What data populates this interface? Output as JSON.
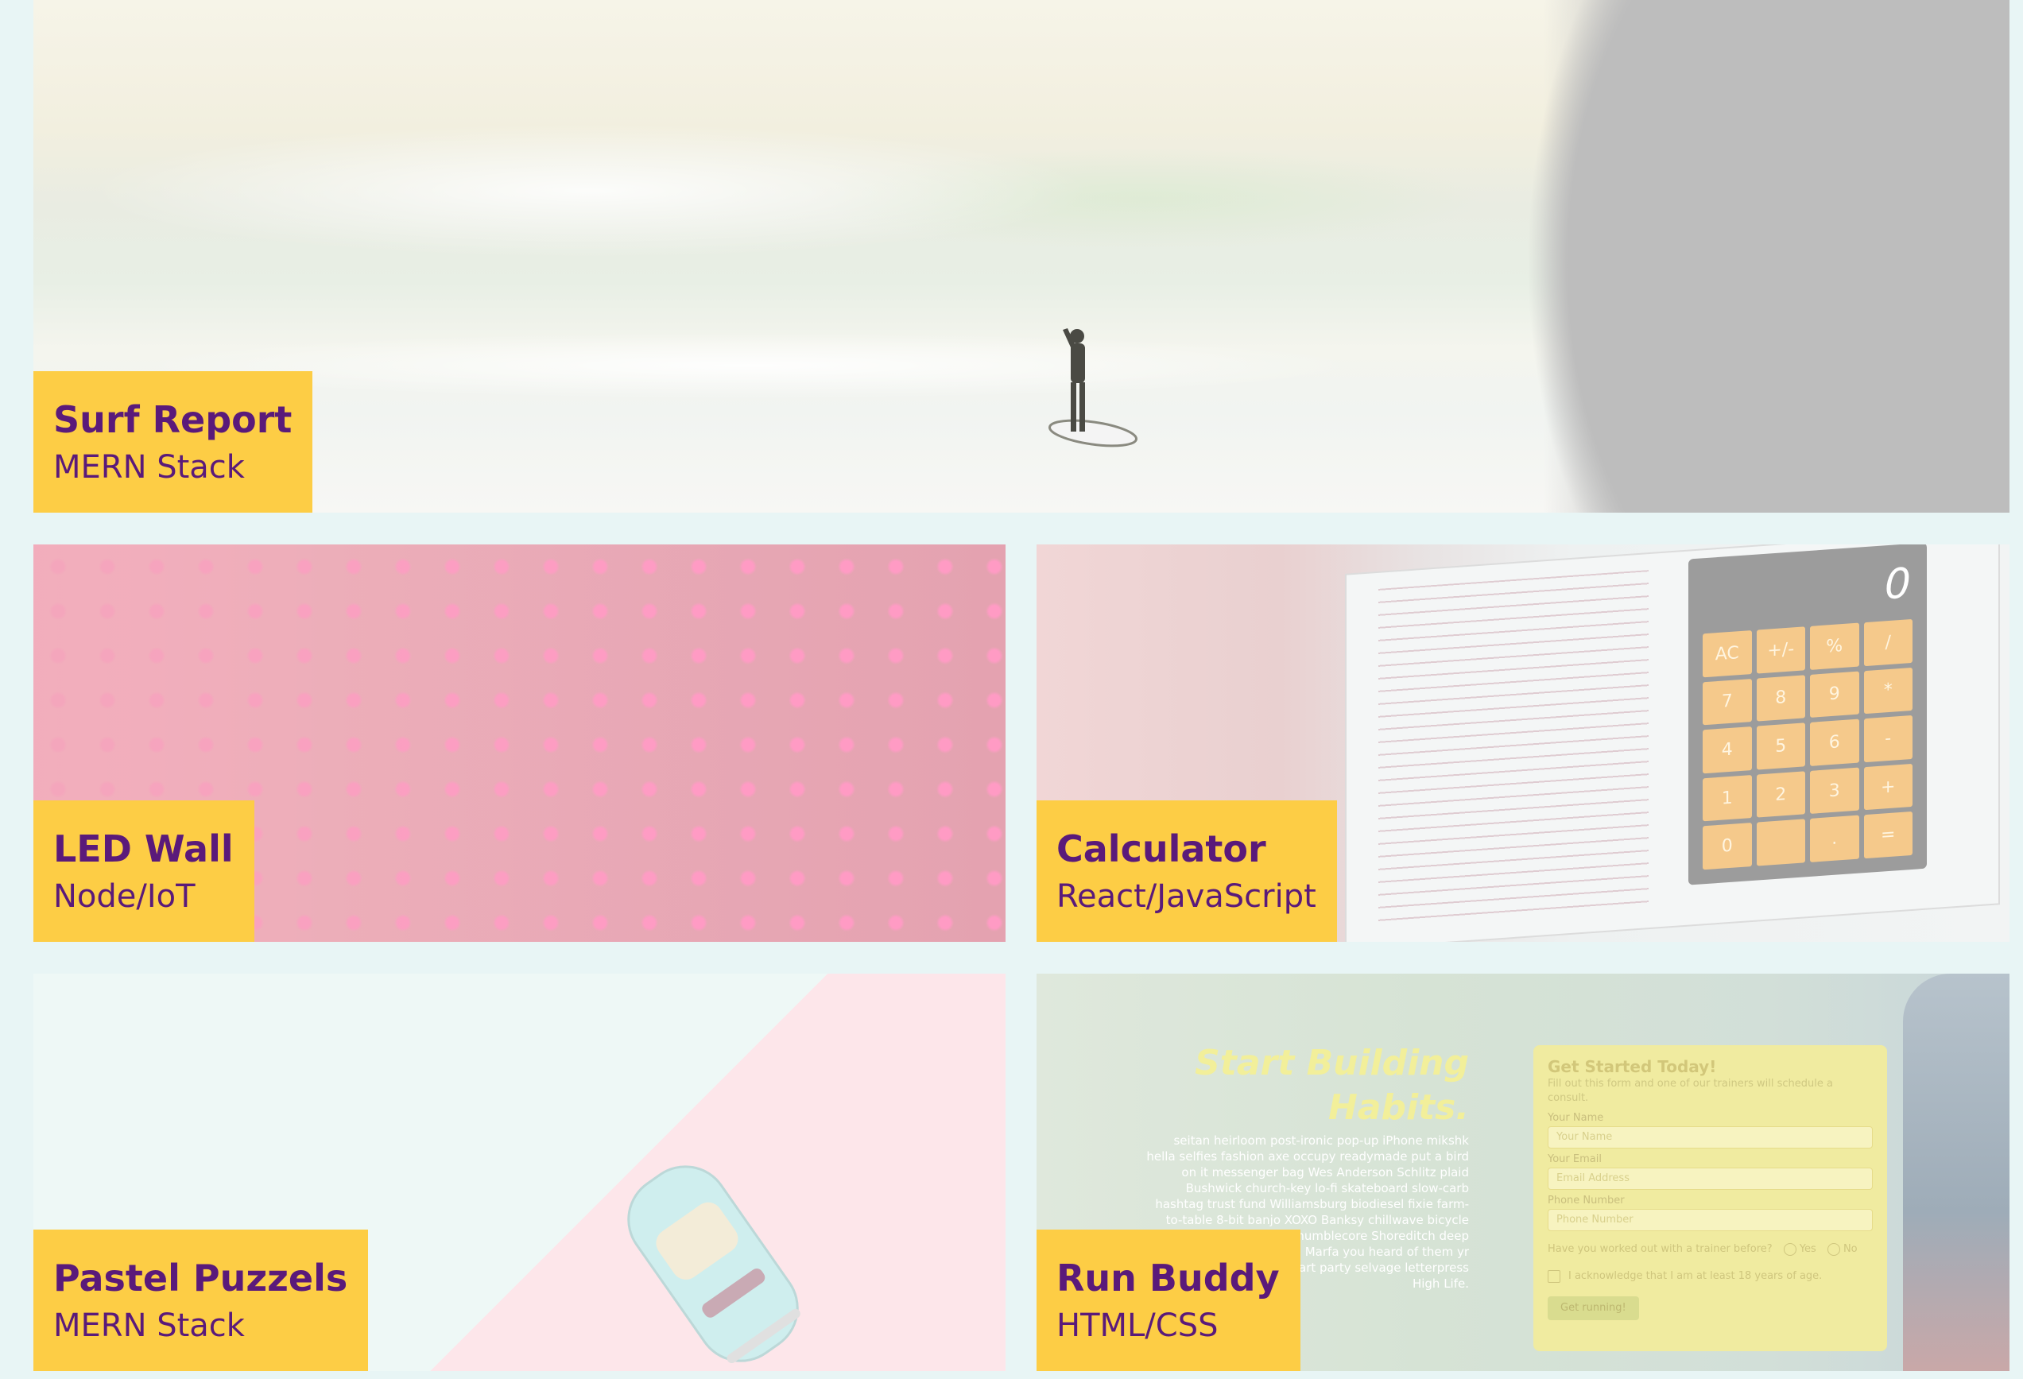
{
  "projects": {
    "surf": {
      "title": "Surf Report",
      "stack": "MERN Stack"
    },
    "led": {
      "title": "LED Wall",
      "stack": "Node/IoT"
    },
    "calc": {
      "title": "Calculator",
      "stack": "React/JavaScript",
      "display": "0",
      "keys": [
        "AC",
        "+/-",
        "%",
        "/",
        "7",
        "8",
        "9",
        "*",
        "4",
        "5",
        "6",
        "-",
        "1",
        "2",
        "3",
        "+",
        "0",
        "",
        ".",
        "="
      ]
    },
    "pastel": {
      "title": "Pastel Puzzels",
      "stack": "MERN Stack"
    },
    "run": {
      "title": "Run Buddy",
      "stack": "HTML/CSS",
      "headline": "Start Building\nHabits.",
      "body": "seitan heirloom post-ironic pop-up iPhone mikshk hella selfies fashion axe occupy readymade put a bird on it messenger bag Wes Anderson Schlitz plaid Bushwick church-key lo-fi skateboard slow-carb hashtag trust fund Williamsburg biodiesel fixie farm-to-table 8-bit banjo XOXO Banksy chillwave bicycle rights retro cliche irony mumblecore Shoreditch deep v bitters cray gentrify tofu Marfa you heard of them yr banh mi asymmetrical art party selvage letterpress High Life.",
      "form": {
        "title": "Get Started Today!",
        "desc": "Fill out this form and one of our trainers will schedule a consult.",
        "name_label": "Your Name",
        "name_placeholder": "Your Name",
        "email_label": "Your Email",
        "email_placeholder": "Email Address",
        "phone_label": "Phone Number",
        "phone_placeholder": "Phone Number",
        "question": "Have you worked out with a trainer before?",
        "yes": "Yes",
        "no": "No",
        "ack": "I acknowledge that I am at least 18 years of age.",
        "button": "Get running!"
      }
    }
  },
  "colors": {
    "label_bg": "#fdcd45",
    "label_text": "#5a1a7a",
    "page_bg": "#e8f5f5"
  }
}
